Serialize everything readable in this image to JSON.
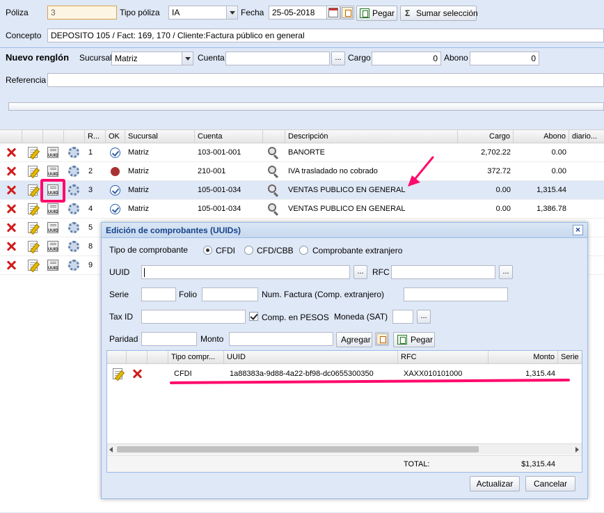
{
  "header": {
    "poliza_label": "Póliza",
    "poliza_value": "3",
    "tipo_poliza_label": "Tipo póliza",
    "tipo_poliza_value": "IA",
    "fecha_label": "Fecha",
    "fecha_value": "25-05-2018",
    "pegar_label": "Pegar",
    "sumar_label": "Sumar selección",
    "concepto_label": "Concepto",
    "concepto_value": "DEPOSITO 105 / Fact:  169,  170 / Cliente:Factura público en general"
  },
  "nuevo_renglon": {
    "title": "Nuevo renglón",
    "sucursal_label": "Sucursal",
    "sucursal_value": "Matriz",
    "cuenta_label": "Cuenta",
    "cuenta_value": "",
    "lookup_label": "...",
    "cargo_label": "Cargo",
    "cargo_value": "0",
    "abono_label": "Abono",
    "abono_value": "0",
    "referencia_label": "Referencia",
    "referencia_value": ""
  },
  "grid": {
    "columns": [
      "R...",
      "OK",
      "Sucursal",
      "Cuenta",
      "Descripción",
      "Cargo",
      "Abono",
      "diario..."
    ],
    "rows": [
      {
        "r": "1",
        "sucursal": "Matriz",
        "cuenta": "103-001-001",
        "descripcion": "BANORTE",
        "cargo": "2,702.22",
        "abono": "0.00",
        "status": "check"
      },
      {
        "r": "2",
        "sucursal": "Matriz",
        "cuenta": "210-001",
        "descripcion": "IVA trasladado no cobrado",
        "cargo": "372.72",
        "abono": "0.00",
        "status": "stop"
      },
      {
        "r": "3",
        "sucursal": "Matriz",
        "cuenta": "105-001-034",
        "descripcion": "VENTAS PUBLICO EN GENERAL",
        "cargo": "0.00",
        "abono": "1,315.44",
        "status": "check"
      },
      {
        "r": "4",
        "sucursal": "Matriz",
        "cuenta": "105-001-034",
        "descripcion": "VENTAS PUBLICO EN GENERAL",
        "cargo": "0.00",
        "abono": "1,386.78",
        "status": "check"
      },
      {
        "r": "5"
      },
      {
        "r": "8"
      },
      {
        "r": "9"
      }
    ],
    "uuid_icon_text": "UUID"
  },
  "dialog": {
    "title": "Edición de comprobantes (UUIDs)",
    "close_label": "×",
    "tipo_label": "Tipo de comprobante",
    "opt_cfdi": "CFDI",
    "opt_cfd": "CFD/CBB",
    "opt_extranjero": "Comprobante extranjero",
    "uuid_label": "UUID",
    "uuid_value": "",
    "rfc_label": "RFC",
    "rfc_value": "",
    "lookup_label": "...",
    "serie_label": "Serie",
    "folio_label": "Folio",
    "numfact_label": "Num. Factura (Comp. extranjero)",
    "taxid_label": "Tax ID",
    "pesos_label": "Comp. en PESOS",
    "moneda_label": "Moneda (SAT)",
    "paridad_label": "Paridad",
    "monto_label": "Monto",
    "agregar_label": "Agregar",
    "pegar_label": "Pegar",
    "columns": [
      "Tipo compr...",
      "UUID",
      "RFC",
      "Monto",
      "Serie"
    ],
    "rows": [
      {
        "tipo": "CFDI",
        "uuid": "1a88383a-9d88-4a22-bf98-dc0655300350",
        "rfc": "XAXX010101000",
        "monto": "1,315.44"
      }
    ],
    "total_label": "TOTAL:",
    "total_value": "$1,315.44",
    "actualizar_label": "Actualizar",
    "cancelar_label": "Cancelar"
  },
  "colors": {
    "highlight": "#ff0a6c",
    "panel": "#dfe8f6",
    "border": "#99bbe8"
  }
}
